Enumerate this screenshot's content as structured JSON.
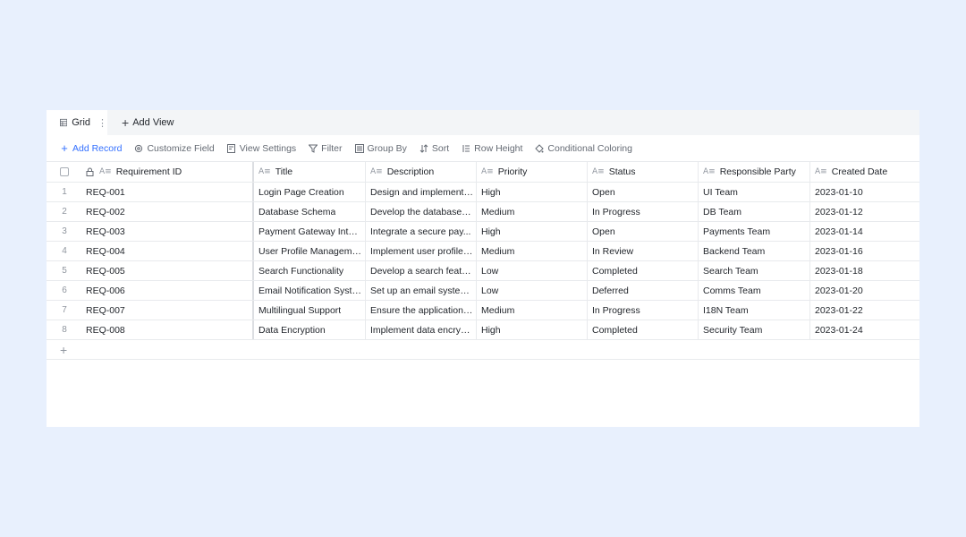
{
  "tabs": {
    "grid_label": "Grid",
    "more_symbol": "⋮",
    "add_view_label": "Add View"
  },
  "toolbar": {
    "add_record": "Add Record",
    "customize_field": "Customize Field",
    "view_settings": "View Settings",
    "filter": "Filter",
    "group_by": "Group By",
    "sort": "Sort",
    "row_height": "Row Height",
    "conditional_coloring": "Conditional Coloring"
  },
  "columns": {
    "requirement_id": "Requirement ID",
    "title": "Title",
    "description": "Description",
    "priority": "Priority",
    "status": "Status",
    "responsible_party": "Responsible Party",
    "created_date": "Created Date"
  },
  "rows": [
    {
      "num": "1",
      "id": "REQ-001",
      "title": "Login Page Creation",
      "description": "Design and implement a...",
      "priority": "High",
      "status": "Open",
      "party": "UI Team",
      "date": "2023-01-10"
    },
    {
      "num": "2",
      "id": "REQ-002",
      "title": "Database Schema",
      "description": "Develop the database sc...",
      "priority": "Medium",
      "status": "In Progress",
      "party": "DB Team",
      "date": "2023-01-12"
    },
    {
      "num": "3",
      "id": "REQ-003",
      "title": "Payment Gateway Integ...",
      "description": "Integrate a secure pay...",
      "priority": "High",
      "status": "Open",
      "party": "Payments Team",
      "date": "2023-01-14"
    },
    {
      "num": "4",
      "id": "REQ-004",
      "title": "User Profile Management",
      "description": "Implement user profile ...",
      "priority": "Medium",
      "status": "In Review",
      "party": "Backend Team",
      "date": "2023-01-16"
    },
    {
      "num": "5",
      "id": "REQ-005",
      "title": "Search Functionality",
      "description": "Develop a search featur...",
      "priority": "Low",
      "status": "Completed",
      "party": "Search Team",
      "date": "2023-01-18"
    },
    {
      "num": "6",
      "id": "REQ-006",
      "title": "Email Notification System",
      "description": "Set up an email system ...",
      "priority": "Low",
      "status": "Deferred",
      "party": "Comms Team",
      "date": "2023-01-20"
    },
    {
      "num": "7",
      "id": "REQ-007",
      "title": "Multilingual Support",
      "description": "Ensure the application s...",
      "priority": "Medium",
      "status": "In Progress",
      "party": "I18N Team",
      "date": "2023-01-22"
    },
    {
      "num": "8",
      "id": "REQ-008",
      "title": "Data Encryption",
      "description": "Implement data encrypt...",
      "priority": "High",
      "status": "Completed",
      "party": "Security Team",
      "date": "2023-01-24"
    }
  ],
  "add_row_symbol": "+",
  "field_type_icon": "A≡"
}
